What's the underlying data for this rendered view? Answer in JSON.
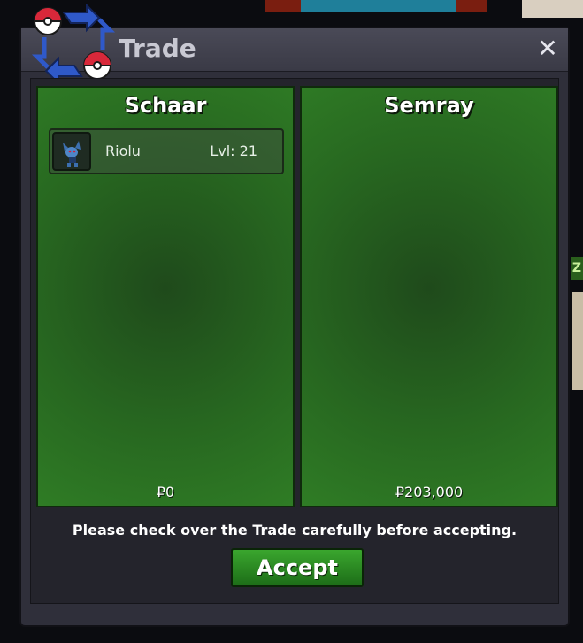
{
  "window": {
    "title": "Trade",
    "close_symbol": "✕"
  },
  "background": {
    "side_text": "Z"
  },
  "trade": {
    "left": {
      "name": "Schaar",
      "money": "₽0",
      "items": [
        {
          "name": "Riolu",
          "level": "Lvl: 21"
        }
      ]
    },
    "right": {
      "name": "Semray",
      "money": "₽203,000",
      "items": []
    }
  },
  "footer": {
    "notice": "Please check over the Trade carefully before accepting.",
    "accept_label": "Accept"
  },
  "colors": {
    "panel_green": "#2f7c25",
    "button_green": "#3aa62e",
    "window_bg": "#2f2f3a"
  },
  "icons": {
    "logo": "trade-pokeball-arrows-icon",
    "close": "close-icon",
    "pokemon": "riolu-icon"
  }
}
